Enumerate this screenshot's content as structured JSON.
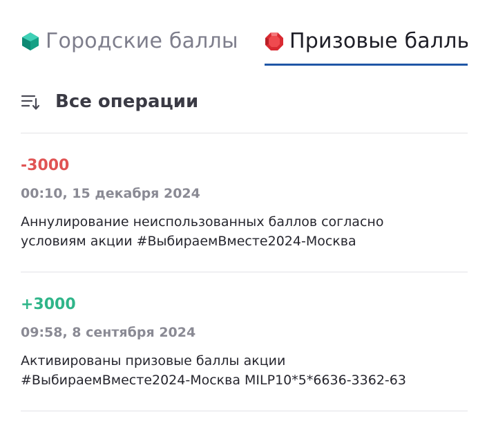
{
  "tabs": [
    {
      "label": "Городские баллы",
      "icon": "green-gem-icon",
      "color": "#1bb09a",
      "active": false
    },
    {
      "label": "Призовые баллы",
      "icon": "red-gem-icon",
      "color": "#e5333a",
      "active": true
    }
  ],
  "active_tab_color": "#1f56a6",
  "filter": {
    "label": "Все операции",
    "icon": "sort-filter-icon"
  },
  "operations": [
    {
      "amount": "-3000",
      "amount_color": "#e05454",
      "date": "00:10, 15 декабря 2024",
      "description_line1": "Аннулирование неиспользованных баллов согласно",
      "description_line2": "условиям акции #ВыбираемВместе2024-Москва"
    },
    {
      "amount": "+3000",
      "amount_color": "#2fb589",
      "date": "09:58, 8 сентября 2024",
      "description_line1": "Активированы призовые баллы акции",
      "description_line2": "#ВыбираемВместе2024-Москва MILP10*5*6636-3362-63"
    }
  ]
}
